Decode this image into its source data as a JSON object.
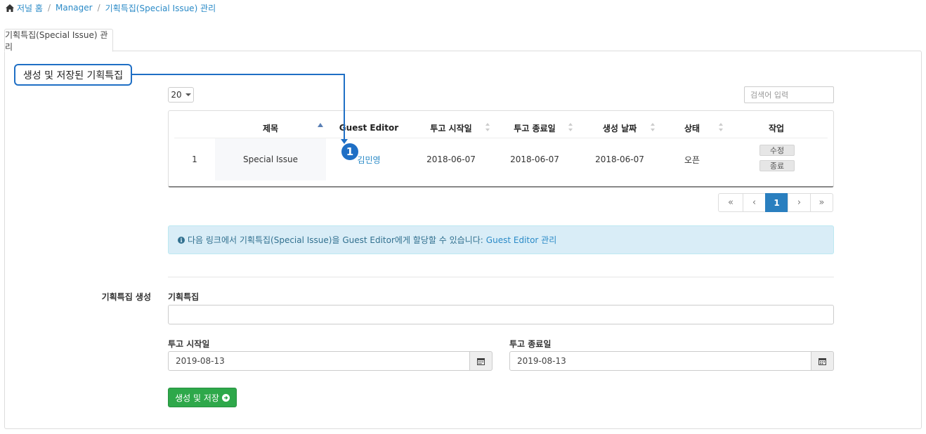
{
  "breadcrumb": {
    "items": [
      {
        "label": "저널 홈"
      },
      {
        "label": "Manager"
      },
      {
        "label": "기획특집(Special Issue) 관리"
      }
    ],
    "separator": "/"
  },
  "tab": {
    "label": "기획특집(Special Issue) 관리"
  },
  "callout": {
    "text": "생성 및 저장된 기획특집",
    "marker": "1"
  },
  "table_controls": {
    "page_size": "20",
    "search_placeholder": "검색어 입력"
  },
  "table": {
    "columns": [
      "제목",
      "Guest Editor",
      "투고 시작일",
      "투고 종료일",
      "생성 날짜",
      "상태",
      "작업"
    ],
    "rows": [
      {
        "no": "1",
        "title": "Special Issue",
        "guest_editor": "김민영",
        "start_date": "2018-06-07",
        "end_date": "2018-06-07",
        "created": "2018-06-07",
        "status": "오픈",
        "actions": [
          "수정",
          "종료"
        ]
      }
    ]
  },
  "pagination": {
    "first": "«",
    "prev": "‹",
    "current": "1",
    "next": "›",
    "last": "»"
  },
  "info": {
    "text": "다음 링크에서 기획특집(Special Issue)을 Guest Editor에게 할당할 수 있습니다:",
    "link": "Guest Editor 관리"
  },
  "form": {
    "section_label": "기획특집 생성",
    "title_label": "기획특집",
    "title_value": "",
    "start_label": "투고 시작일",
    "start_value": "2019-08-13",
    "end_label": "투고 종료일",
    "end_value": "2019-08-13",
    "submit_label": "생성 및 저장"
  },
  "colors": {
    "link": "#2a8ac7",
    "callout": "#1f6fc5",
    "info_bg": "#d9edf7",
    "primary_button": "#2ea84a",
    "active_page": "#2a7fbf"
  },
  "icons": {
    "home": "home-icon",
    "sort": "sort-icon",
    "info": "info-icon",
    "calendar": "calendar-icon",
    "submit": "arrow-circle-right-icon"
  }
}
